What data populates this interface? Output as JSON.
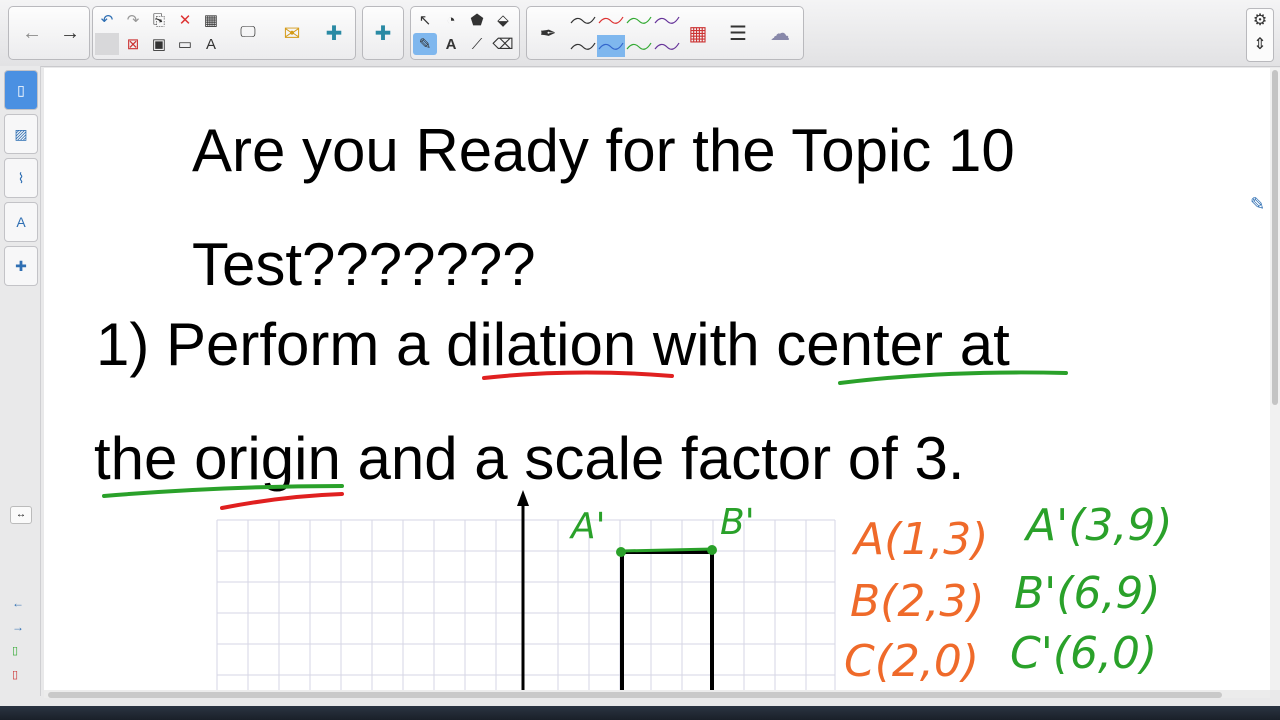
{
  "toolbar": {
    "groups": [
      "navigation",
      "page",
      "tools",
      "pens",
      "colors"
    ],
    "accent_color": "#7fb7ee"
  },
  "sidebar": {
    "tabs": [
      "page-sorter",
      "gallery",
      "attachments",
      "properties",
      "addons"
    ]
  },
  "slide": {
    "title_line1": "Are you Ready for the Topic 10",
    "title_line2": "Test???????",
    "question_line1": "1) Perform a dilation with center at",
    "question_line2": "the origin and a scale factor of 3."
  },
  "handwriting": {
    "orange_colour": "#ef6a2a",
    "green_colour": "#2aa12a",
    "label_a_prime": "A'",
    "label_b_prime": "B'",
    "orange": [
      "A(1,3)",
      "B(2,3)",
      "C(2,0)"
    ],
    "green": [
      "A'(3,9)",
      "B'(6,9)",
      "C'(6,0)"
    ]
  }
}
